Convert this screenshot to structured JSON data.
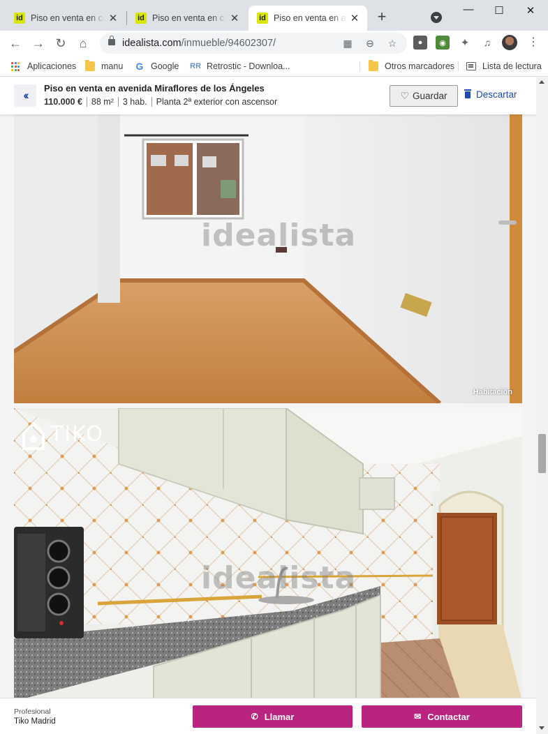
{
  "browser": {
    "tabs": [
      {
        "favicon": "id",
        "title": "Piso en venta en calle",
        "active": false
      },
      {
        "favicon": "id",
        "title": "Piso en venta en calle",
        "active": false
      },
      {
        "favicon": "id",
        "title": "Piso en venta en avenida",
        "active": true
      }
    ],
    "new_tab": "+",
    "url_domain": "idealista.com",
    "url_path": "/inmueble/94602307/",
    "bookmarks": [
      {
        "label": "Aplicaciones",
        "icon": "apps-grid-icon"
      },
      {
        "label": "manu",
        "icon": "folder-icon"
      },
      {
        "label": "Google",
        "icon": "google-icon"
      },
      {
        "label": "Retrostic - Downloa...",
        "icon": "retrostic-icon"
      }
    ],
    "other_bookmarks": "Otros marcadores",
    "reading_list": "Lista de lectura"
  },
  "listing": {
    "title": "Piso en venta en avenida Miraflores de los Ángeles",
    "price": "110.000 €",
    "size": "88 m²",
    "rooms": "3 hab.",
    "floor": "Planta 2ª exterior con ascensor",
    "save_label": "Guardar",
    "discard_label": "Descartar"
  },
  "photos": [
    {
      "watermark": "idealista",
      "label": "Habitación"
    },
    {
      "watermark": "idealista",
      "brand": "TIKO"
    }
  ],
  "contact": {
    "type": "Profesional",
    "name": "Tiko Madrid",
    "call_label": "Llamar",
    "contact_label": "Contactar"
  },
  "colors": {
    "accent_cta": "#b8247f",
    "link_blue": "#1f4bb4",
    "favicon": "#d8e600"
  }
}
